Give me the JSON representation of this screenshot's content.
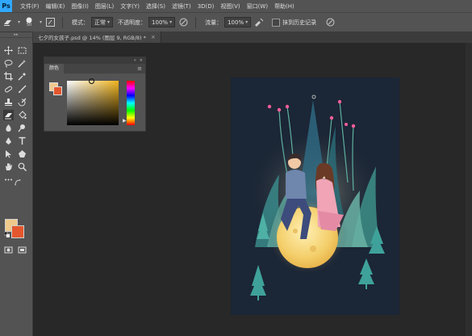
{
  "app": {
    "logo": "Ps"
  },
  "menubar": {
    "items": [
      "文件(F)",
      "编辑(E)",
      "图像(I)",
      "图层(L)",
      "文字(Y)",
      "选择(S)",
      "滤镜(T)",
      "3D(D)",
      "视图(V)",
      "窗口(W)",
      "帮助(H)"
    ]
  },
  "options": {
    "brush_size": "50",
    "mode_label": "模式：",
    "mode_value": "正常",
    "opacity_label": "不透明度：",
    "opacity_value": "100%",
    "flow_label": "流量：",
    "flow_value": "100%",
    "history_label": "抹到历史记录"
  },
  "document": {
    "tab_label": "七夕的女孩子.psd @ 14% (图层 9, RGB/8) *",
    "close_symbol": "×"
  },
  "color_panel": {
    "tab_label": "颜色",
    "collapse_symbol": "«",
    "close_symbol": "×",
    "menu_symbol": "≡"
  },
  "colors": {
    "foreground": "#f0c98a",
    "background": "#e4572e",
    "app_bg": "#282828",
    "panel_bg": "#535353",
    "canvas_bg": "#1b2636"
  },
  "icons": [
    "move-icon",
    "marquee-icon",
    "lasso-icon",
    "magic-wand-icon",
    "crop-icon",
    "eyedropper-icon",
    "healing-icon",
    "brush-icon",
    "stamp-icon",
    "history-brush-icon",
    "eraser-icon",
    "paint-bucket-icon",
    "blur-icon",
    "dodge-icon",
    "pen-icon",
    "type-icon",
    "path-select-icon",
    "shape-icon",
    "hand-icon",
    "zoom-icon",
    "more-tools-icon",
    "quick-mask-icon",
    "screen-mode-icon"
  ]
}
